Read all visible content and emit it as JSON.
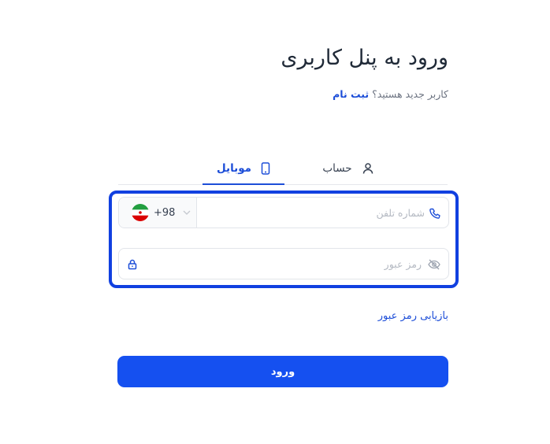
{
  "header": {
    "title": "ورود به پنل کاربری",
    "register_prompt": "کاربر جدید هستید؟",
    "register_link": "ثبت نام"
  },
  "tabs": [
    {
      "label": "موبایل",
      "icon": "smartphone-icon",
      "active": true
    },
    {
      "label": "حساب",
      "icon": "user-icon",
      "active": false
    }
  ],
  "form": {
    "phone": {
      "placeholder": "شماره تلفن",
      "value": ""
    },
    "country_code": "+98",
    "country_flag": "iran-flag-icon",
    "password": {
      "placeholder": "رمز عبور",
      "value": ""
    },
    "forgot_password": "بازیابی رمز عبور",
    "submit_label": "ورود"
  },
  "colors": {
    "accent": "#1550f0",
    "link": "#1d4ed8",
    "focus_frame": "#1140e0",
    "text": "#1f2937"
  }
}
